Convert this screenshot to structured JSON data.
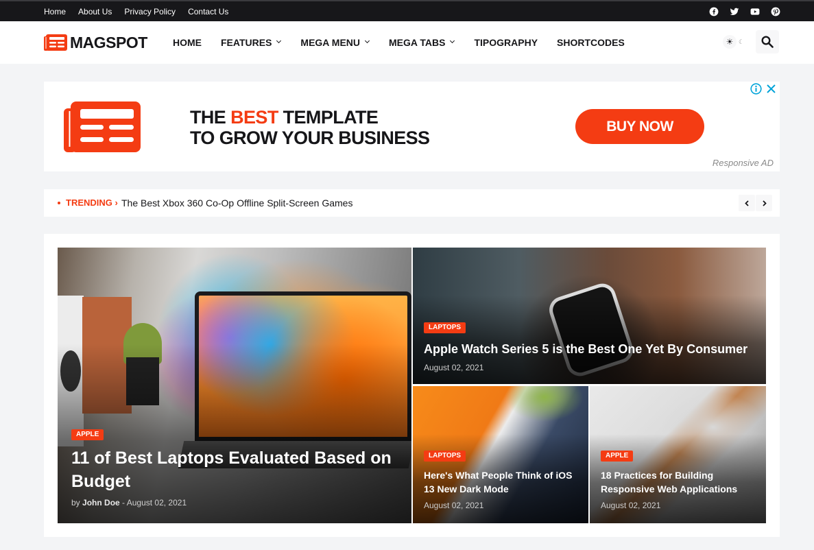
{
  "topbar": {
    "links": [
      "Home",
      "About Us",
      "Privacy Policy",
      "Contact Us"
    ],
    "social": [
      "facebook-icon",
      "twitter-icon",
      "youtube-icon",
      "pinterest-icon"
    ]
  },
  "header": {
    "logo_text": "MAGSPOT",
    "nav": [
      {
        "label": "HOME",
        "dropdown": false
      },
      {
        "label": "FEATURES",
        "dropdown": true
      },
      {
        "label": "MEGA MENU",
        "dropdown": true
      },
      {
        "label": "MEGA TABS",
        "dropdown": true
      },
      {
        "label": "TIPOGRAPHY",
        "dropdown": false
      },
      {
        "label": "SHORTCODES",
        "dropdown": false
      }
    ],
    "mode_sun": "☀",
    "mode_moon": "☾"
  },
  "ad": {
    "headline_pre": "THE ",
    "headline_accent": "BEST",
    "headline_post": " TEMPLATE",
    "headline_line2": "TO GROW YOUR BUSINESS",
    "cta": "BUY NOW",
    "label": "Responsive AD"
  },
  "trending": {
    "label": "TRENDING",
    "arrow": "›",
    "text": "The Best Xbox 360 Co-Op Offline Split-Screen Games"
  },
  "posts": [
    {
      "category": "APPLE",
      "title": "11 of Best Laptops Evaluated Based on Budget",
      "by": "by",
      "author": "John Doe",
      "separator": " - ",
      "date": "August 02, 2021"
    },
    {
      "category": "LAPTOPS",
      "title": "Apple Watch Series 5 is the Best One Yet By Consumer",
      "date": "August 02, 2021"
    },
    {
      "category": "LAPTOPS",
      "title": "Here's What People Think of iOS 13 New Dark Mode",
      "date": "August 02, 2021"
    },
    {
      "category": "APPLE",
      "title": "18 Practices for Building Responsive Web Applications",
      "date": "August 02, 2021"
    }
  ],
  "colors": {
    "accent": "#f43c13",
    "topbar": "#17171a",
    "background": "#f3f4f6"
  }
}
